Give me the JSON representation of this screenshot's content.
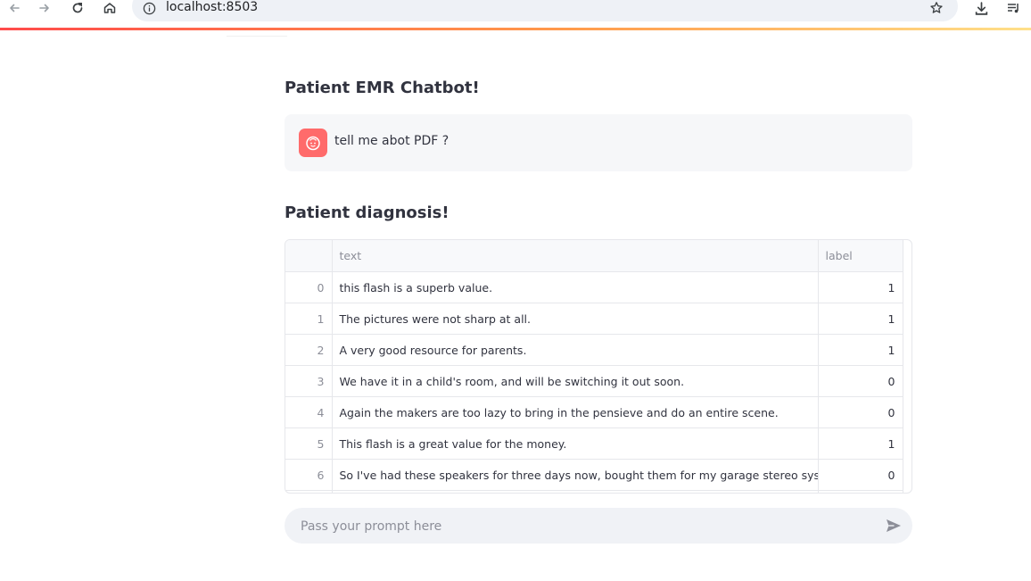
{
  "browser": {
    "url": "localhost:8503"
  },
  "chat_title": "Patient EMR Chatbot!",
  "messages": [
    {
      "text": "tell me abot PDF ?"
    }
  ],
  "diagnosis_title": "Patient diagnosis!",
  "table": {
    "columns": [
      "",
      "text",
      "label"
    ],
    "rows": [
      {
        "index": "0",
        "text": "this flash is a superb value.",
        "label": "1"
      },
      {
        "index": "1",
        "text": "The pictures were not sharp at all.",
        "label": "1"
      },
      {
        "index": "2",
        "text": "A very good resource for parents.",
        "label": "1"
      },
      {
        "index": "3",
        "text": "We have it in a child's room, and will be switching it out soon.",
        "label": "0"
      },
      {
        "index": "4",
        "text": "Again the makers are too lazy to bring in the pensieve and do an entire scene.",
        "label": "0"
      },
      {
        "index": "5",
        "text": "This flash is a great value for the money.",
        "label": "1"
      },
      {
        "index": "6",
        "text": "So I've had these speakers for three days now, bought them for my garage stereo system.",
        "label": "0"
      }
    ]
  },
  "chat_input": {
    "placeholder": "Pass your prompt here",
    "value": ""
  },
  "colors": {
    "accent": "#ff4b4b",
    "avatar": "#ff6b6b",
    "text": "#31333f",
    "muted": "#8c8e98"
  }
}
